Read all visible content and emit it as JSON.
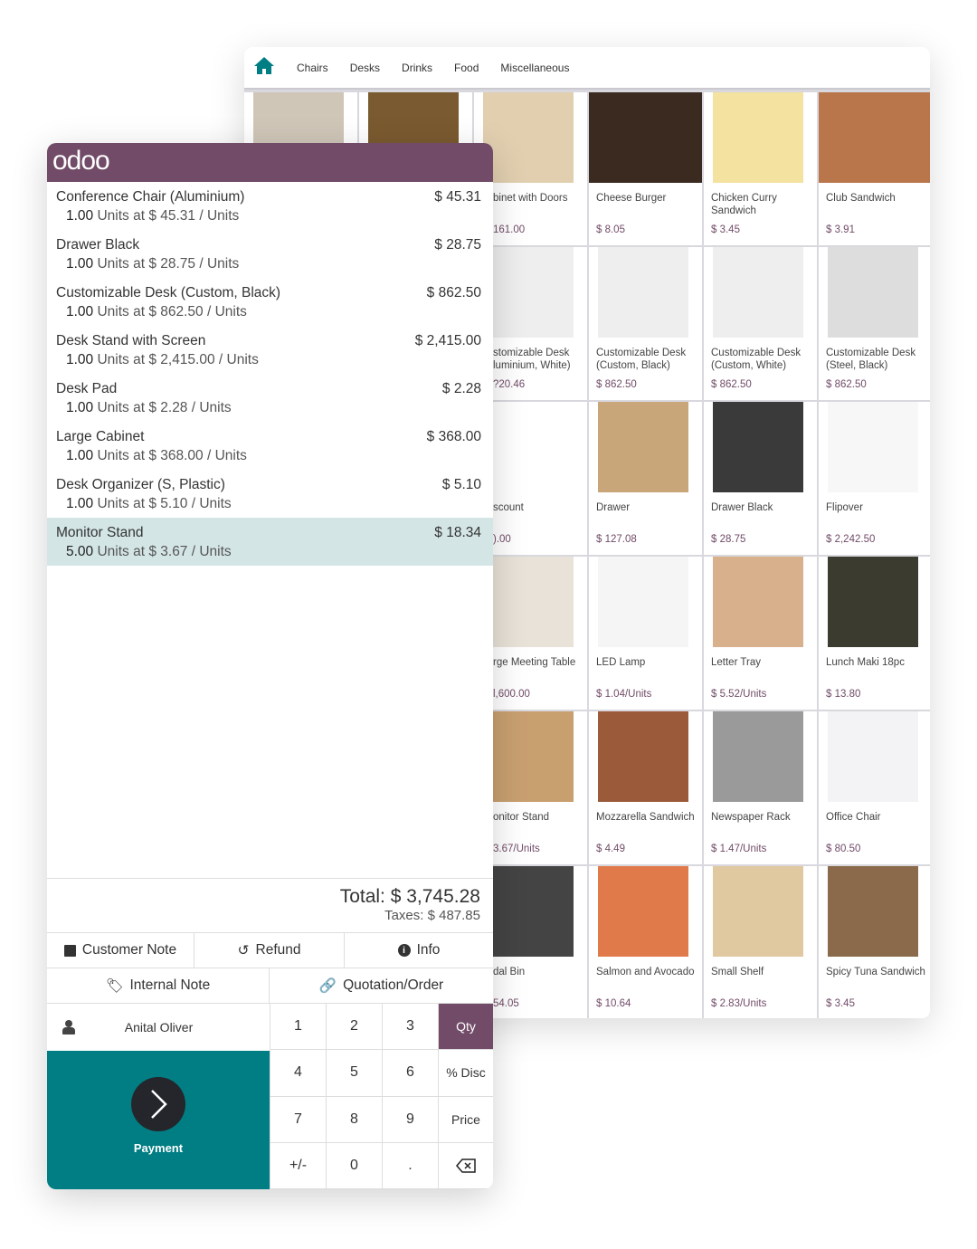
{
  "colors": {
    "brand": "#714B67",
    "payment": "#017E84",
    "selected_line": "#d4e5e6"
  },
  "categories": [
    "Chairs",
    "Desks",
    "Drinks",
    "Food",
    "Miscellaneous"
  ],
  "products": [
    {
      "name": "",
      "price": "",
      "img": "#cfc6b8"
    },
    {
      "name": "",
      "price": "",
      "img": "#7a5a30"
    },
    {
      "name": "binet with Doors",
      "price": "161.00",
      "img": "#e2cfb0",
      "c3": true
    },
    {
      "name": "Cheese Burger",
      "price": "$ 8.05",
      "img": "#3a2a20"
    },
    {
      "name": "Chicken Curry Sandwich",
      "price": "$ 3.45",
      "img": "#f3e2a0"
    },
    {
      "name": "Club Sandwich",
      "price": "$ 3.91",
      "img": "#b8764a"
    },
    {
      "name": "",
      "price": "",
      "img": "#f3f3f5"
    },
    {
      "name": "",
      "price": "",
      "img": "#f3f3f5"
    },
    {
      "name": "stomizable Desk luminium, White)",
      "price": "?20.46",
      "img": "#eeeeee",
      "c3": true
    },
    {
      "name": "Customizable Desk (Custom, Black)",
      "price": "$ 862.50",
      "img": "#eeeeee"
    },
    {
      "name": "Customizable Desk (Custom, White)",
      "price": "$ 862.50",
      "img": "#eeeeee"
    },
    {
      "name": "Customizable Desk (Steel, Black)",
      "price": "$ 862.50",
      "img": "#dddddd"
    },
    {
      "name": "",
      "price": "",
      "img": "#f3f3f5"
    },
    {
      "name": "",
      "price": "",
      "img": "#f3f3f5"
    },
    {
      "name": "scount",
      "price": ").00",
      "img": "#ffffff",
      "c3": true
    },
    {
      "name": "Drawer",
      "price": "$ 127.08",
      "img": "#c9a67a"
    },
    {
      "name": "Drawer Black",
      "price": "$ 28.75",
      "img": "#3a3a3a"
    },
    {
      "name": "Flipover",
      "price": "$ 2,242.50",
      "img": "#f7f7f7"
    },
    {
      "name": "",
      "price": "",
      "img": "#f3f3f5"
    },
    {
      "name": "",
      "price": "",
      "img": "#f3f3f5"
    },
    {
      "name": "rge Meeting Table",
      "price": "l,600.00",
      "img": "#e8e2d8",
      "c3": true
    },
    {
      "name": "LED Lamp",
      "price": "$ 1.04/Units",
      "img": "#f5f5f5"
    },
    {
      "name": "Letter Tray",
      "price": "$ 5.52/Units",
      "img": "#d9b08c"
    },
    {
      "name": "Lunch Maki 18pc",
      "price": "$ 13.80",
      "img": "#3b3b2f"
    },
    {
      "name": "",
      "price": "",
      "img": "#f3f3f5"
    },
    {
      "name": "",
      "price": "",
      "img": "#f3f3f5"
    },
    {
      "name": "onitor Stand",
      "price": "3.67/Units",
      "img": "#c8a070",
      "c3": true
    },
    {
      "name": "Mozzarella Sandwich",
      "price": "$ 4.49",
      "img": "#9b5a3a"
    },
    {
      "name": "Newspaper Rack",
      "price": "$ 1.47/Units",
      "img": "#9a9a9a"
    },
    {
      "name": "Office Chair",
      "price": "$ 80.50",
      "img": "#f3f3f5"
    },
    {
      "name": "",
      "price": "",
      "img": "#f3f3f5"
    },
    {
      "name": "",
      "price": "",
      "img": "#f3f3f5"
    },
    {
      "name": "dal Bin",
      "price": "54.05",
      "img": "#444444",
      "c3": true
    },
    {
      "name": "Salmon and Avocado",
      "price": "$ 10.64",
      "img": "#e07a4a"
    },
    {
      "name": "Small Shelf",
      "price": "$ 2.83/Units",
      "img": "#e0c9a0"
    },
    {
      "name": "Spicy Tuna Sandwich",
      "price": "$ 3.45",
      "img": "#8a6a4a"
    }
  ],
  "order": {
    "logo": "odoo",
    "lines": [
      {
        "name": "Conference Chair (Aluminium)",
        "total": "$ 45.31",
        "qty": "1.00",
        "detail": "Units at $ 45.31 / Units"
      },
      {
        "name": "Drawer Black",
        "total": "$ 28.75",
        "qty": "1.00",
        "detail": "Units at $ 28.75 / Units"
      },
      {
        "name": "Customizable Desk (Custom, Black)",
        "total": "$ 862.50",
        "qty": "1.00",
        "detail": "Units at $ 862.50 / Units"
      },
      {
        "name": "Desk Stand with Screen",
        "total": "$ 2,415.00",
        "qty": "1.00",
        "detail": "Units at $ 2,415.00 / Units"
      },
      {
        "name": "Desk Pad",
        "total": "$ 2.28",
        "qty": "1.00",
        "detail": "Units at $ 2.28 / Units"
      },
      {
        "name": "Large Cabinet",
        "total": "$ 368.00",
        "qty": "1.00",
        "detail": "Units at $ 368.00 / Units"
      },
      {
        "name": "Desk Organizer (S, Plastic)",
        "total": "$ 5.10",
        "qty": "1.00",
        "detail": "Units at $ 5.10 / Units"
      },
      {
        "name": "Monitor Stand",
        "total": "$ 18.34",
        "qty": "5.00",
        "detail": "Units at $ 3.67 / Units",
        "selected": true
      }
    ],
    "total": "Total: $ 3,745.28",
    "taxes": "Taxes: $ 487.85"
  },
  "actions": {
    "customer_note": "Customer Note",
    "refund": "Refund",
    "info": "Info",
    "internal_note": "Internal Note",
    "quotation": "Quotation/Order"
  },
  "customer": "Anital Oliver",
  "payment": "Payment",
  "numpad": [
    "1",
    "2",
    "3",
    "Qty",
    "4",
    "5",
    "6",
    "% Disc",
    "7",
    "8",
    "9",
    "Price",
    "+/-",
    "0",
    "."
  ],
  "numpad_active": "Qty"
}
